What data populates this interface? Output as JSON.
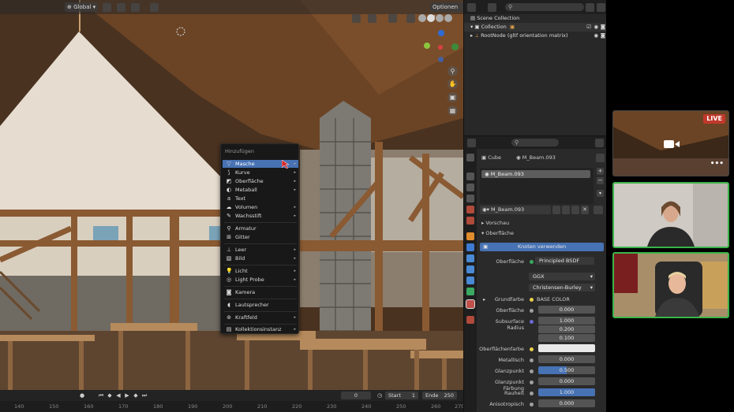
{
  "viewport": {
    "header": {
      "orientation": "Global",
      "options_label": "Optionen"
    },
    "gizmo_axes": [
      "Y",
      "X",
      "Z"
    ]
  },
  "add_menu": {
    "title": "Hinzufügen",
    "items": [
      {
        "label": "Masche",
        "icon": "mesh-icon",
        "submenu": true,
        "active": true
      },
      {
        "label": "Kurve",
        "icon": "curve-icon",
        "submenu": true
      },
      {
        "label": "Oberfläche",
        "icon": "surface-icon",
        "submenu": true
      },
      {
        "label": "Metaball",
        "icon": "metaball-icon",
        "submenu": true
      },
      {
        "label": "Text",
        "icon": "text-icon",
        "submenu": false
      },
      {
        "label": "Volumen",
        "icon": "volume-icon",
        "submenu": true
      },
      {
        "label": "Wachsstift",
        "icon": "grease-pencil-icon",
        "submenu": true
      },
      {
        "label": "Armatur",
        "icon": "armature-icon",
        "submenu": false
      },
      {
        "label": "Gitter",
        "icon": "lattice-icon",
        "submenu": false
      },
      {
        "label": "Leer",
        "icon": "empty-icon",
        "submenu": true
      },
      {
        "label": "Bild",
        "icon": "image-icon",
        "submenu": true
      },
      {
        "label": "Licht",
        "icon": "light-icon",
        "submenu": true
      },
      {
        "label": "Light Probe",
        "icon": "light-probe-icon",
        "submenu": true
      },
      {
        "label": "Kamera",
        "icon": "camera-icon",
        "submenu": false
      },
      {
        "label": "Lautsprecher",
        "icon": "speaker-icon",
        "submenu": false
      },
      {
        "label": "Kraftfeld",
        "icon": "force-field-icon",
        "submenu": true
      },
      {
        "label": "Kollektionsinstanz",
        "icon": "collection-instance-icon",
        "submenu": true
      }
    ]
  },
  "timeline": {
    "current_frame": "0",
    "start_label": "Start",
    "start_value": "1",
    "end_label": "Ende",
    "end_value": "250",
    "ticks": [
      "140",
      "150",
      "160",
      "170",
      "180",
      "190",
      "200",
      "210",
      "220",
      "230",
      "240",
      "250",
      "260",
      "270"
    ]
  },
  "outliner": {
    "rows": [
      {
        "label": "Scene Collection"
      },
      {
        "label": "Collection"
      },
      {
        "label": "RootNode (gltf orientation matrix)"
      }
    ]
  },
  "properties": {
    "object_name": "Cube",
    "material_name": "M_Beam.093",
    "slot_name": "M_Beam.093",
    "datablock_name": "M_Beam.093",
    "sections": {
      "preview": "Vorschau",
      "surface": "Oberfläche"
    },
    "use_nodes_button": "Knoten verwenden",
    "rows": {
      "surface_label": "Oberfläche",
      "surface_value": "Principled BSDF",
      "distribution": "GGX",
      "subsurface_method": "Christensen-Burley",
      "base_color_label": "Grundfarbe",
      "base_color_value": "BASE COLOR",
      "subsurface_label": "Oberfläche",
      "subsurface_value": "0.000",
      "subsurface_radius_label": "Subsurface Radius",
      "radius_1": "1.000",
      "radius_2": "0.200",
      "radius_3": "0.100",
      "subsurface_color_label": "Oberflächenfarbe",
      "metallic_label": "Metallisch",
      "metallic_value": "0.000",
      "specular_label": "Glanzpunkt",
      "specular_value": "0.500",
      "specular_tint_label": "Glanzpunkt Färbung",
      "specular_tint_value": "0.000",
      "roughness_label": "Rauheit",
      "roughness_value": "1.000",
      "anisotropic_label": "Anisotropisch",
      "anisotropic_value": "0.000"
    }
  },
  "video_call": {
    "live_label": "LIVE"
  },
  "colors": {
    "accent_blue": "#4772b3",
    "active_speaker_border": "#3bb54a",
    "live_red": "#c0392b"
  }
}
